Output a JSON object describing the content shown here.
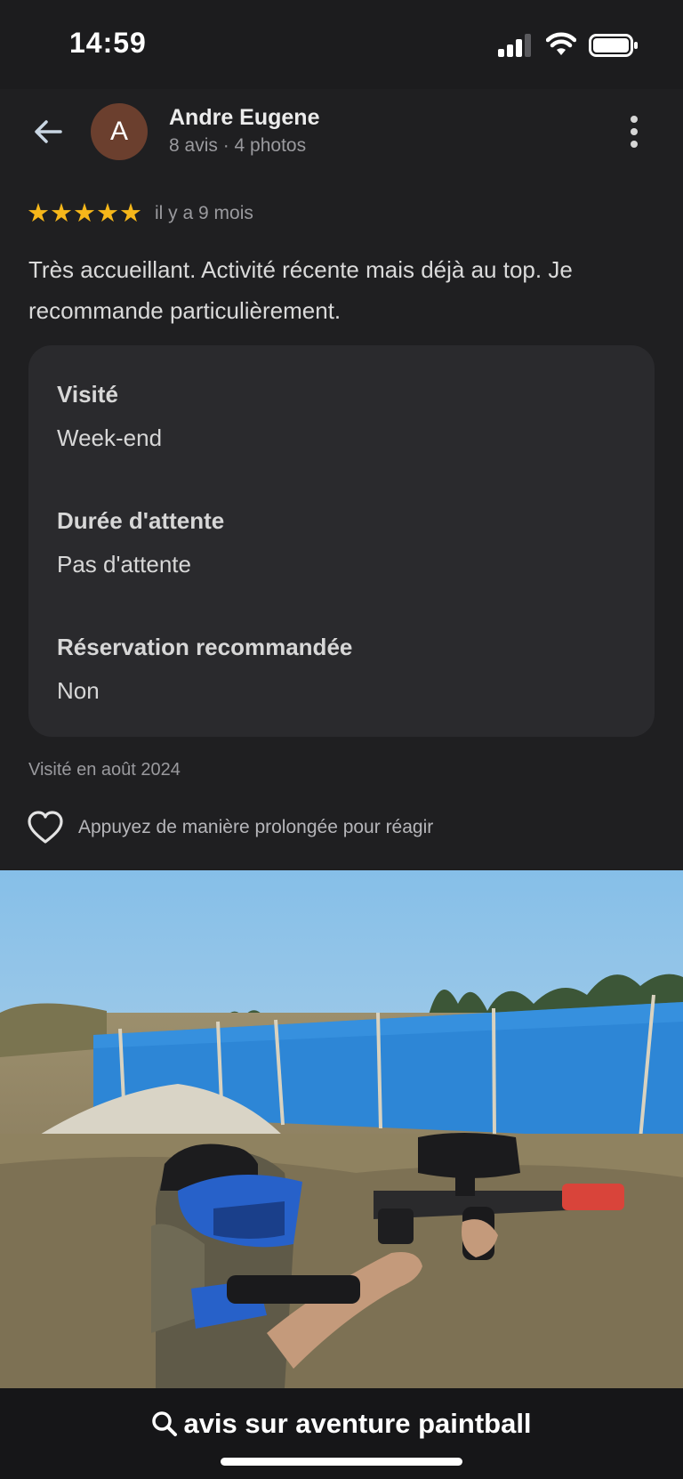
{
  "status_bar": {
    "time": "14:59"
  },
  "header": {
    "avatar_letter": "A",
    "reviewer_name": "Andre Eugene",
    "reviewer_meta": "8 avis · 4 photos"
  },
  "review": {
    "stars": "★★★★★",
    "rating_value": 5,
    "time_ago": "il y a 9 mois",
    "text": "Très accueillant. Activité récente mais déjà au top. Je recommande particulièrement."
  },
  "details": [
    {
      "label": "Visité",
      "value": "Week-end"
    },
    {
      "label": "Durée d'attente",
      "value": "Pas d'attente"
    },
    {
      "label": "Réservation recommandée",
      "value": "Non"
    }
  ],
  "visited_date": "Visité en août 2024",
  "reaction": {
    "hint": "Appuyez de manière prolongée pour réagir"
  },
  "bottom_bar": {
    "search_label": "avis sur aventure paintball"
  },
  "colors": {
    "background": "#1f1f21",
    "card": "#2a2a2d",
    "star": "#f6b71a",
    "avatar": "#6b3f2e"
  },
  "icons": [
    "back-arrow-icon",
    "more-vert-icon",
    "heart-icon",
    "search-icon",
    "signal-icon",
    "wifi-icon",
    "battery-icon"
  ]
}
